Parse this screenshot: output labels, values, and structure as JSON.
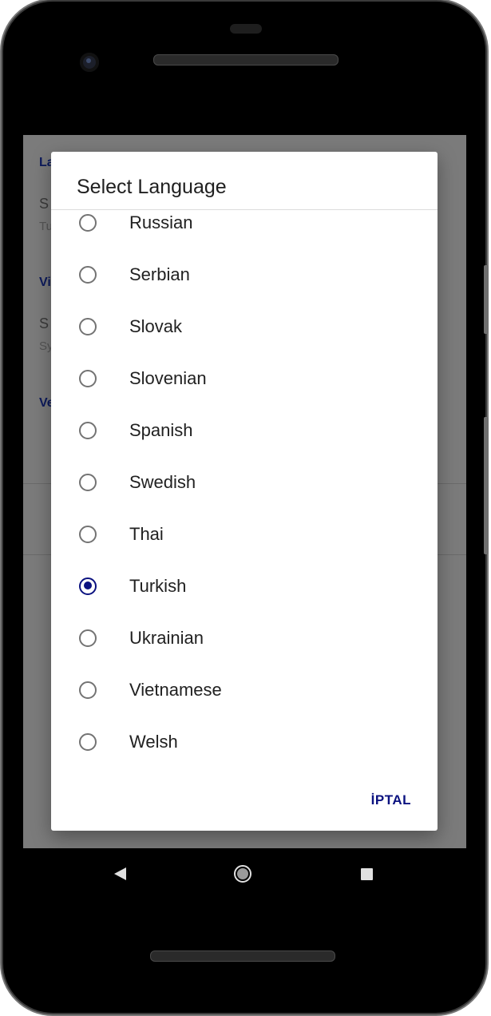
{
  "background_settings": {
    "section1_header": "La",
    "item1_title": "S",
    "item1_sub": "Tu",
    "section2_header": "Vi",
    "item2_title": "S",
    "item2_sub": "Sy",
    "section3_header": "Ve"
  },
  "dialog": {
    "title": "Select Language",
    "options": [
      {
        "label": "Russian",
        "selected": false
      },
      {
        "label": "Serbian",
        "selected": false
      },
      {
        "label": "Slovak",
        "selected": false
      },
      {
        "label": "Slovenian",
        "selected": false
      },
      {
        "label": "Spanish",
        "selected": false
      },
      {
        "label": "Swedish",
        "selected": false
      },
      {
        "label": "Thai",
        "selected": false
      },
      {
        "label": "Turkish",
        "selected": true
      },
      {
        "label": "Ukrainian",
        "selected": false
      },
      {
        "label": "Vietnamese",
        "selected": false
      },
      {
        "label": "Welsh",
        "selected": false
      }
    ],
    "cancel_label": "İPTAL"
  },
  "nav_bar": {
    "back_icon": "back-triangle-icon",
    "home_icon": "home-circle-icon",
    "recents_icon": "recents-square-icon"
  },
  "colors": {
    "accent": "#0b1280",
    "scrim": "#7b7b7b"
  }
}
